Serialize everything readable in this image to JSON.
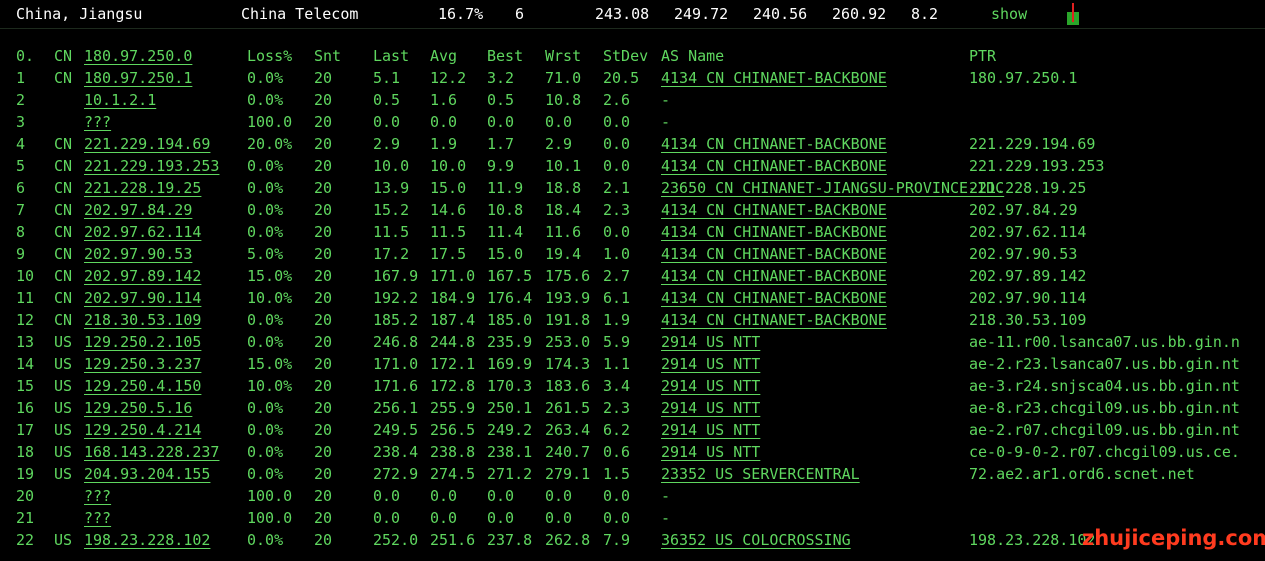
{
  "summary": {
    "location": "China, Jiangsu",
    "isp": "China Telecom",
    "loss": "16.7%",
    "count": "6",
    "last": "243.08",
    "avg": "249.72",
    "best": "240.56",
    "worst": "260.92",
    "stdev": "8.2",
    "action": "show"
  },
  "columns": [
    "0.",
    "CN",
    "180.97.250.0",
    "Loss%",
    "Snt",
    "Last",
    "Avg",
    "Best",
    "Wrst",
    "StDev",
    "AS Name",
    "PTR"
  ],
  "rows": [
    [
      "1",
      "CN",
      "180.97.250.1",
      "0.0%",
      "20",
      "5.1",
      "12.2",
      "3.2",
      "71.0",
      "20.5",
      "4134  CN CHINANET-BACKBONE",
      "180.97.250.1"
    ],
    [
      "2",
      "",
      "10.1.2.1",
      "0.0%",
      "20",
      "0.5",
      "1.6",
      "0.5",
      "10.8",
      "2.6",
      "-",
      ""
    ],
    [
      "3",
      "",
      "???",
      "100.0",
      "20",
      "0.0",
      "0.0",
      "0.0",
      "0.0",
      "0.0",
      "-",
      ""
    ],
    [
      "4",
      "CN",
      "221.229.194.69",
      "20.0%",
      "20",
      "2.9",
      "1.9",
      "1.7",
      "2.9",
      "0.0",
      "4134  CN CHINANET-BACKBONE",
      "221.229.194.69"
    ],
    [
      "5",
      "CN",
      "221.229.193.253",
      "0.0%",
      "20",
      "10.0",
      "10.0",
      "9.9",
      "10.1",
      "0.0",
      "4134  CN CHINANET-BACKBONE",
      "221.229.193.253"
    ],
    [
      "6",
      "CN",
      "221.228.19.25",
      "0.0%",
      "20",
      "13.9",
      "15.0",
      "11.9",
      "18.8",
      "2.1",
      "23650 CN CHINANET-JIANGSU-PROVINCE-IDC",
      "221.228.19.25"
    ],
    [
      "7",
      "CN",
      "202.97.84.29",
      "0.0%",
      "20",
      "15.2",
      "14.6",
      "10.8",
      "18.4",
      "2.3",
      "4134  CN CHINANET-BACKBONE",
      "202.97.84.29"
    ],
    [
      "8",
      "CN",
      "202.97.62.114",
      "0.0%",
      "20",
      "11.5",
      "11.5",
      "11.4",
      "11.6",
      "0.0",
      "4134  CN CHINANET-BACKBONE",
      "202.97.62.114"
    ],
    [
      "9",
      "CN",
      "202.97.90.53",
      "5.0%",
      "20",
      "17.2",
      "17.5",
      "15.0",
      "19.4",
      "1.0",
      "4134  CN CHINANET-BACKBONE",
      "202.97.90.53"
    ],
    [
      "10",
      "CN",
      "202.97.89.142",
      "15.0%",
      "20",
      "167.9",
      "171.0",
      "167.5",
      "175.6",
      "2.7",
      "4134  CN CHINANET-BACKBONE",
      "202.97.89.142"
    ],
    [
      "11",
      "CN",
      "202.97.90.114",
      "10.0%",
      "20",
      "192.2",
      "184.9",
      "176.4",
      "193.9",
      "6.1",
      "4134  CN CHINANET-BACKBONE",
      "202.97.90.114"
    ],
    [
      "12",
      "CN",
      "218.30.53.109",
      "0.0%",
      "20",
      "185.2",
      "187.4",
      "185.0",
      "191.8",
      "1.9",
      "4134  CN CHINANET-BACKBONE",
      "218.30.53.109"
    ],
    [
      "13",
      "US",
      "129.250.2.105",
      "0.0%",
      "20",
      "246.8",
      "244.8",
      "235.9",
      "253.0",
      "5.9",
      "2914  US NTT",
      "ae-11.r00.lsanca07.us.bb.gin.n"
    ],
    [
      "14",
      "US",
      "129.250.3.237",
      "15.0%",
      "20",
      "171.0",
      "172.1",
      "169.9",
      "174.3",
      "1.1",
      "2914  US NTT",
      "ae-2.r23.lsanca07.us.bb.gin.nt"
    ],
    [
      "15",
      "US",
      "129.250.4.150",
      "10.0%",
      "20",
      "171.6",
      "172.8",
      "170.3",
      "183.6",
      "3.4",
      "2914  US NTT",
      "ae-3.r24.snjsca04.us.bb.gin.nt"
    ],
    [
      "16",
      "US",
      "129.250.5.16",
      "0.0%",
      "20",
      "256.1",
      "255.9",
      "250.1",
      "261.5",
      "2.3",
      "2914  US NTT",
      "ae-8.r23.chcgil09.us.bb.gin.nt"
    ],
    [
      "17",
      "US",
      "129.250.4.214",
      "0.0%",
      "20",
      "249.5",
      "256.5",
      "249.2",
      "263.4",
      "6.2",
      "2914  US NTT",
      "ae-2.r07.chcgil09.us.bb.gin.nt"
    ],
    [
      "18",
      "US",
      "168.143.228.237",
      "0.0%",
      "20",
      "238.4",
      "238.8",
      "238.1",
      "240.7",
      "0.6",
      "2914  US NTT",
      "ce-0-9-0-2.r07.chcgil09.us.ce."
    ],
    [
      "19",
      "US",
      "204.93.204.155",
      "0.0%",
      "20",
      "272.9",
      "274.5",
      "271.2",
      "279.1",
      "1.5",
      "23352 US SERVERCENTRAL",
      "72.ae2.ar1.ord6.scnet.net"
    ],
    [
      "20",
      "",
      "???",
      "100.0",
      "20",
      "0.0",
      "0.0",
      "0.0",
      "0.0",
      "0.0",
      "-",
      ""
    ],
    [
      "21",
      "",
      "???",
      "100.0",
      "20",
      "0.0",
      "0.0",
      "0.0",
      "0.0",
      "0.0",
      "-",
      ""
    ],
    [
      "22",
      "US",
      "198.23.228.102",
      "0.0%",
      "20",
      "252.0",
      "251.6",
      "237.8",
      "262.8",
      "7.9",
      "36352 US COLOCROSSING",
      "198.23.228.102"
    ]
  ],
  "watermark": "zhujiceping.com",
  "colors": {
    "background": "#000000",
    "text": "#5fd75f",
    "header": "#ffffff",
    "watermark": "#ff3b1f"
  },
  "icons": {
    "graph": "bar-graph-icon"
  }
}
